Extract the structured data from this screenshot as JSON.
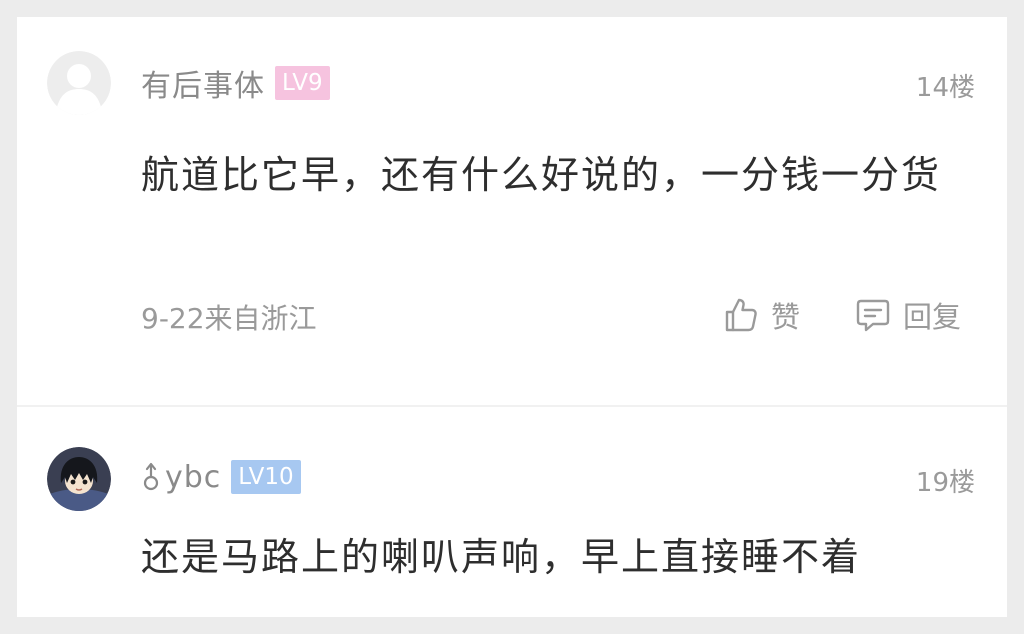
{
  "comments": [
    {
      "username": "有后事体",
      "level": "LV9",
      "floor": "14楼",
      "content": "航道比它早，还有什么好说的，一分钱一分货",
      "meta": "9-22来自浙江",
      "like_label": "赞",
      "reply_label": "回复",
      "avatar_icon": "default-avatar-icon",
      "badge_color": "#f6c3df"
    },
    {
      "username": "ybc",
      "level": "LV10",
      "floor": "19楼",
      "content": "还是马路上的喇叭声响，早上直接睡不着",
      "avatar_icon": "anime-avatar-icon",
      "gender_icon": "male-gender-icon",
      "badge_color": "#a7c8f1"
    }
  ],
  "colors": {
    "background": "#ececec",
    "card": "#ffffff",
    "text_primary": "#2e2e2e",
    "text_secondary": "#9a9a9a"
  }
}
